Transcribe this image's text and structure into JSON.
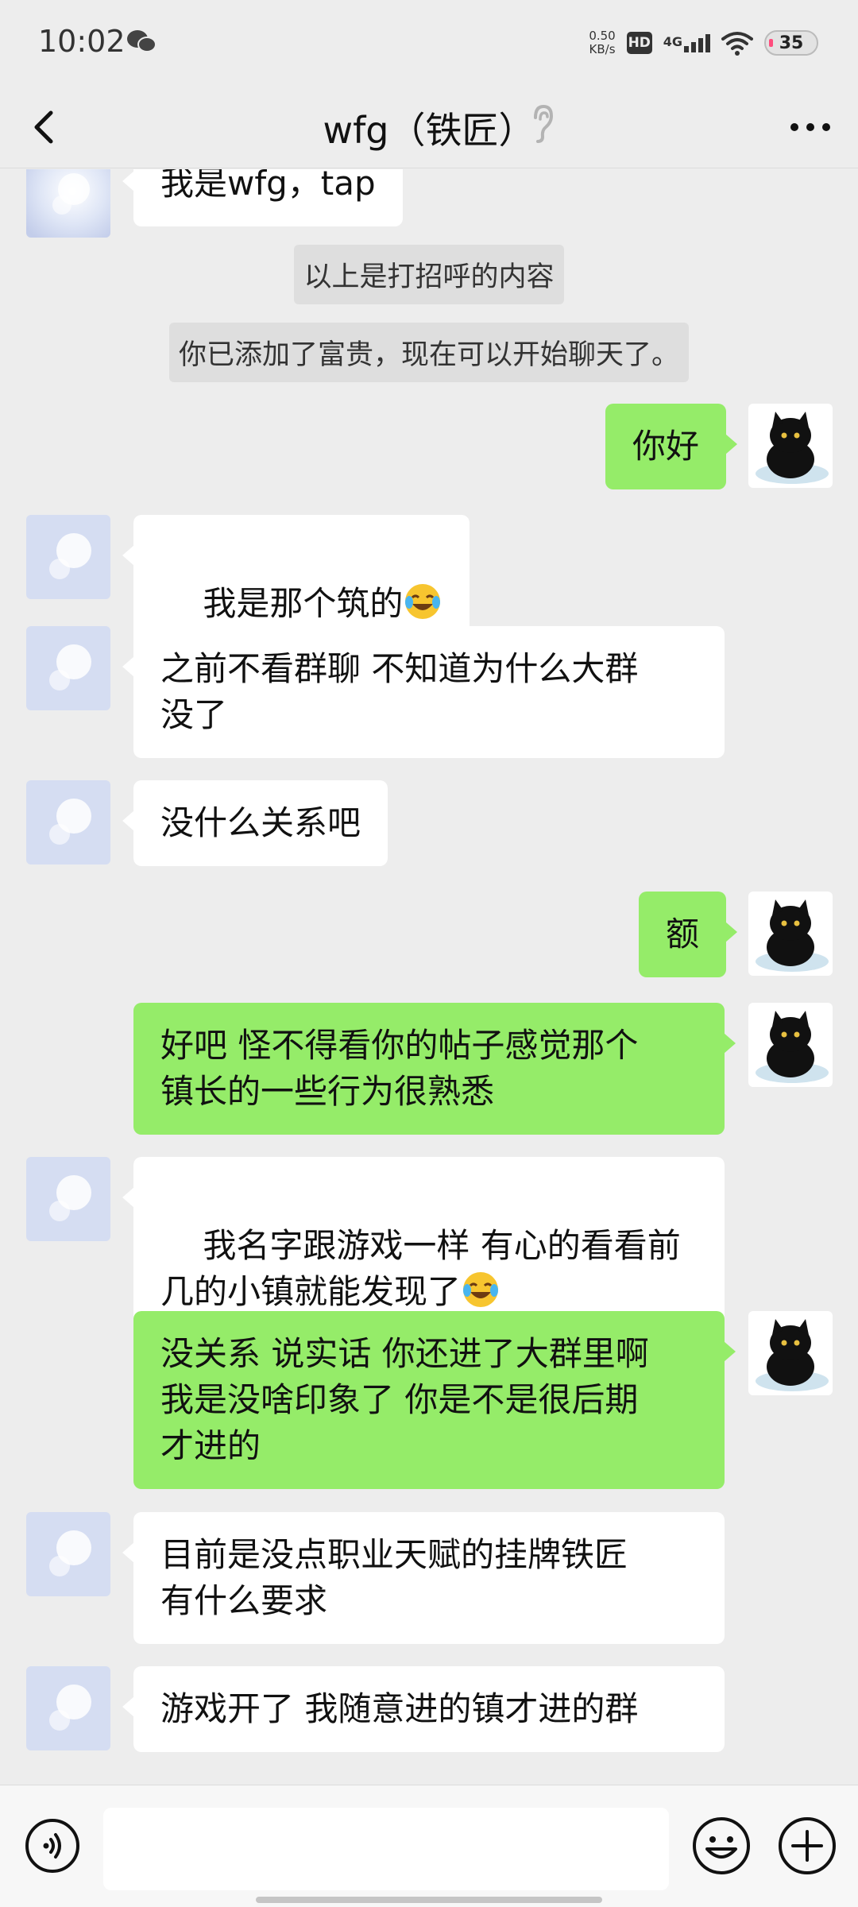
{
  "status_bar": {
    "time": "10:02",
    "net_speed_value": "0.50",
    "net_speed_unit": "KB/s",
    "hd": "HD",
    "network": "4G",
    "battery": "35"
  },
  "header": {
    "title": "wfg（铁匠）"
  },
  "messages": [
    {
      "type": "in",
      "text": "我是wfg，tap"
    },
    {
      "type": "system",
      "text": "以上是打招呼的内容"
    },
    {
      "type": "system",
      "text": "你已添加了富贵，现在可以开始聊天了。"
    },
    {
      "type": "out",
      "text": "你好"
    },
    {
      "type": "in",
      "text": "我是那个筑的",
      "emoji": "laugh-cry-emoji"
    },
    {
      "type": "in",
      "text": "之前不看群聊 不知道为什么大群\n没了"
    },
    {
      "type": "in",
      "text": "没什么关系吧"
    },
    {
      "type": "out",
      "text": "额"
    },
    {
      "type": "out",
      "text": "好吧 怪不得看你的帖子感觉那个\n镇长的一些行为很熟悉"
    },
    {
      "type": "in",
      "text": "我名字跟游戏一样 有心的看看前\n几的小镇就能发现了",
      "emoji": "laugh-cry-emoji"
    },
    {
      "type": "out",
      "text": "没关系 说实话 你还进了大群里啊\n我是没啥印象了 你是不是很后期\n才进的"
    },
    {
      "type": "in",
      "text": "目前是没点职业天赋的挂牌铁匠\n有什么要求"
    },
    {
      "type": "in",
      "text": "游戏开了 我随意进的镇才进的群"
    }
  ],
  "input_bar": {
    "draft": ""
  },
  "colors": {
    "background": "#ededed",
    "bubble_out": "#95ec69",
    "bubble_in": "#ffffff"
  }
}
